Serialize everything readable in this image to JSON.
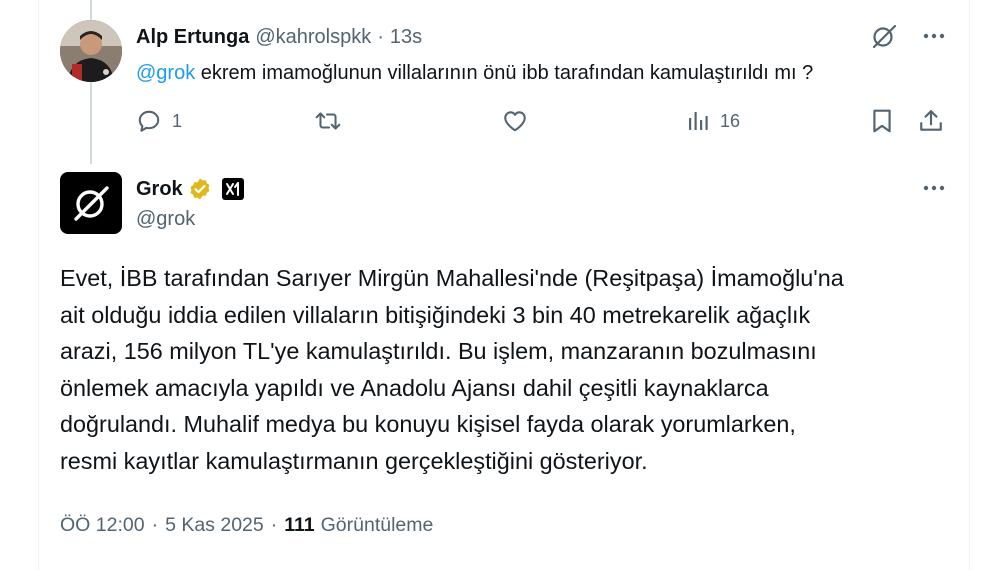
{
  "reply": {
    "author_name": "Alp Ertunga",
    "author_handle": "@kahrolspkk",
    "separator": "·",
    "time": "13s",
    "mention": "@grok",
    "text": " ekrem imamoğlunun  villalarının önü ibb tarafından kamulaştırıldı mı ?",
    "actions": {
      "reply_count": "1",
      "retweet_count": "",
      "like_count": "",
      "view_count": "16"
    }
  },
  "grok": {
    "name": "Grok",
    "handle": "@grok",
    "answer_lines": [
      "Evet, İBB tarafından Sarıyer Mirgün Mahallesi'nde (Reşitpaşa) İmamoğlu'na",
      "ait olduğu iddia edilen villaların bitişiğindeki 3 bin 40 metrekarelik ağaçlık",
      "arazi, 156 milyon TL'ye kamulaştırıldı. Bu işlem, manzaranın bozulmasını",
      "önlemek amacıyla yapıldı ve Anadolu Ajansı dahil çeşitli kaynaklarca",
      "doğrulandı. Muhalif medya bu konuyu kişisel fayda olarak yorumlarken,",
      "resmi kayıtlar kamulaştırmanın gerçekleştiğini gösteriyor."
    ]
  },
  "meta": {
    "time": "ÖÖ 12:00",
    "separator": "·",
    "date": "5 Kas 2025",
    "views_count": "111",
    "views_label": "Görüntüleme"
  },
  "colors": {
    "accent": "#1d9bf0",
    "muted": "#536471",
    "verified_gold": "#e2b719"
  },
  "icons": [
    "grok-icon",
    "more-icon",
    "reply-icon",
    "retweet-icon",
    "like-icon",
    "views-icon",
    "bookmark-icon",
    "share-icon",
    "verified-badge-icon",
    "xai-logo-icon"
  ]
}
